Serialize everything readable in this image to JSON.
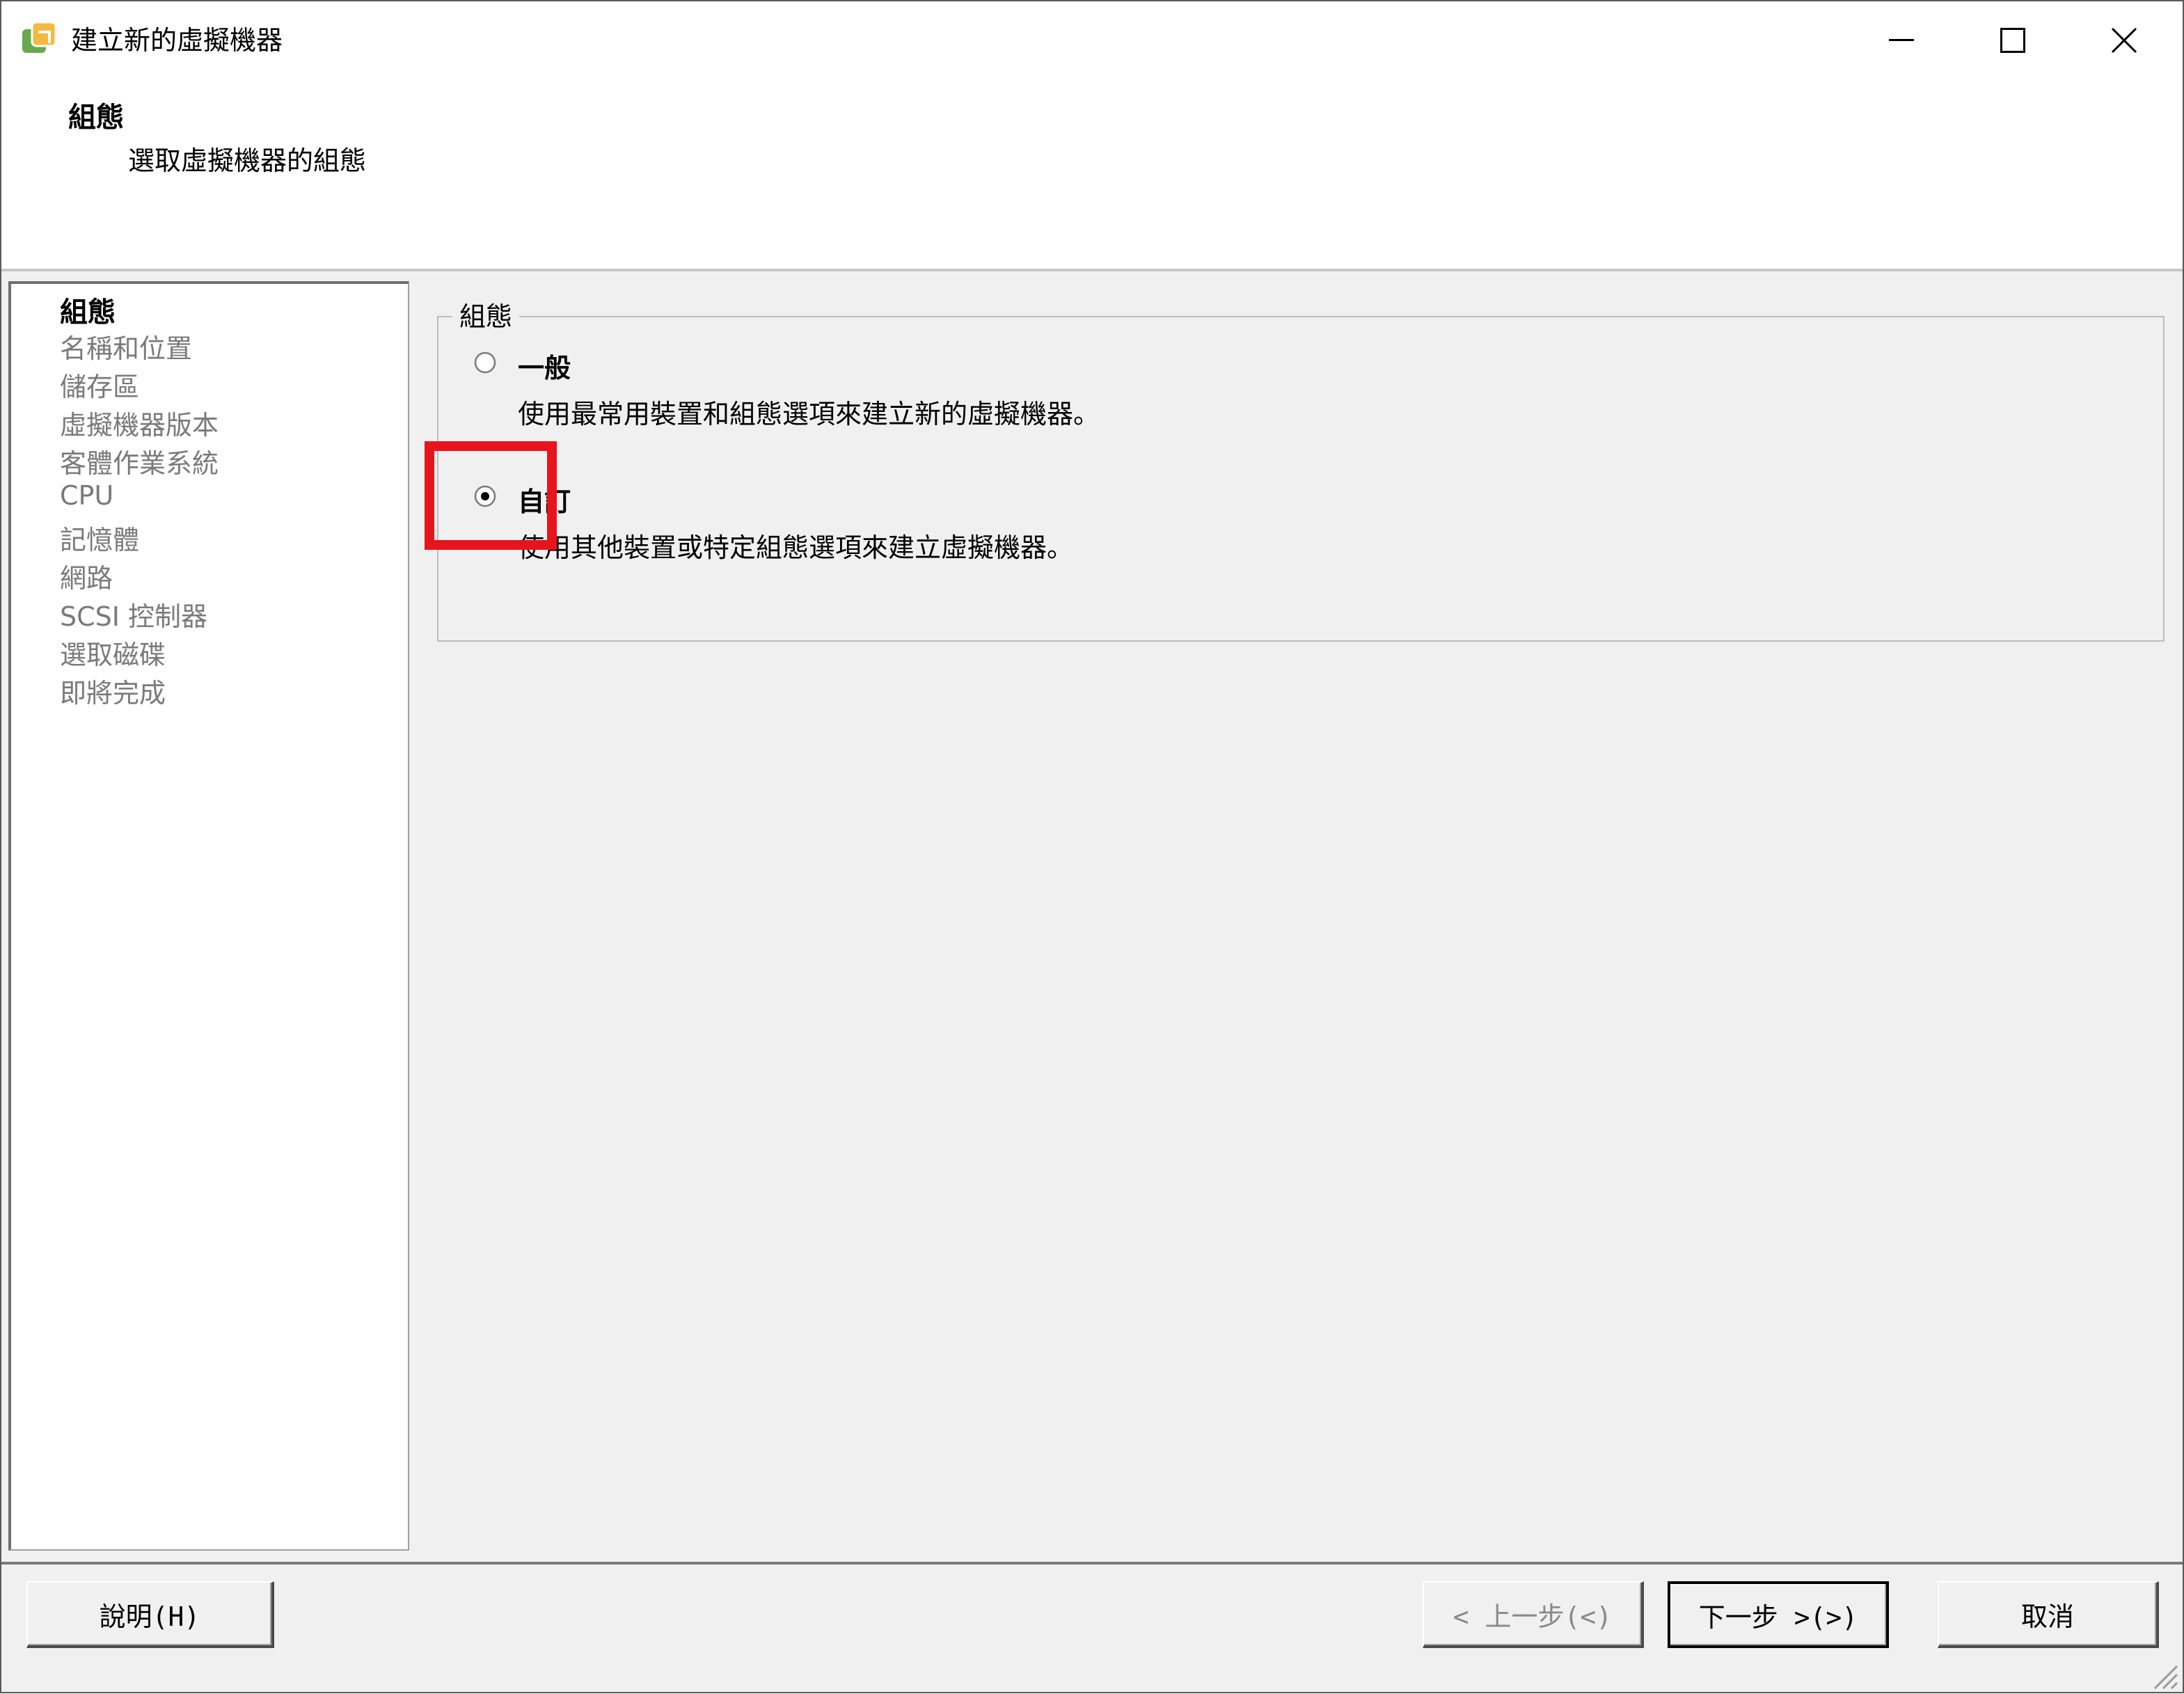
{
  "window": {
    "title": "建立新的虛擬機器",
    "controls": [
      "minimize",
      "maximize",
      "close"
    ]
  },
  "header": {
    "title": "組態",
    "subtitle": "選取虛擬機器的組態"
  },
  "nav": {
    "items": [
      {
        "label": "組態",
        "active": true
      },
      {
        "label": "名稱和位置",
        "active": false
      },
      {
        "label": "儲存區",
        "active": false
      },
      {
        "label": "虛擬機器版本",
        "active": false
      },
      {
        "label": "客體作業系統",
        "active": false
      },
      {
        "label": "CPU",
        "active": false
      },
      {
        "label": "記憶體",
        "active": false
      },
      {
        "label": "網路",
        "active": false
      },
      {
        "label": "SCSI 控制器",
        "active": false
      },
      {
        "label": "選取磁碟",
        "active": false
      },
      {
        "label": "即將完成",
        "active": false
      }
    ]
  },
  "config": {
    "group_label": "組態",
    "options": [
      {
        "label": "一般",
        "description": "使用最常用裝置和組態選項來建立新的虛擬機器。",
        "selected": false
      },
      {
        "label": "自訂",
        "description": "使用其他裝置或特定組態選項來建立虛擬機器。",
        "selected": true
      }
    ],
    "highlight_color": "#e8141c"
  },
  "buttons": {
    "help": "說明(H)",
    "back": "< 上一步(<)",
    "next": "下一步 >(>)",
    "cancel": "取消"
  }
}
